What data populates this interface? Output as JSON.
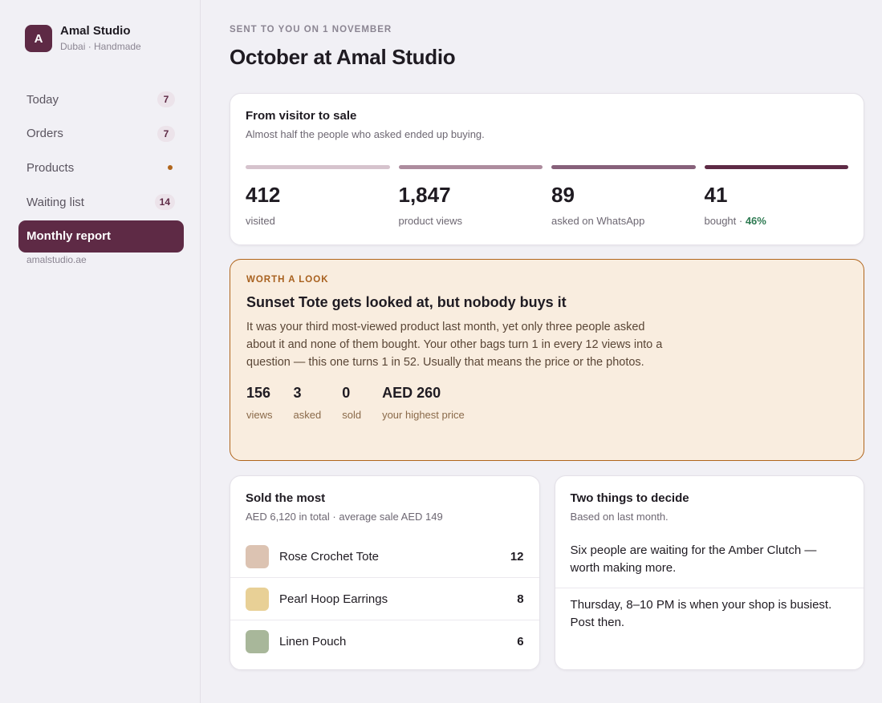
{
  "brand": {
    "initial": "A",
    "name": "Amal Studio",
    "subtitle": "Dubai · Handmade"
  },
  "nav": {
    "items": [
      {
        "label": "Today",
        "badge": "7"
      },
      {
        "label": "Orders",
        "badge": "7"
      },
      {
        "label": "Products",
        "indicator": "dot"
      },
      {
        "label": "Waiting list",
        "badge": "14"
      },
      {
        "label": "Monthly report",
        "active": true
      }
    ],
    "site": "amalstudio.ae"
  },
  "header": {
    "kicker": "SENT TO YOU ON 1 NOVEMBER",
    "title": "October at Amal Studio"
  },
  "funnel": {
    "title": "From visitor to sale",
    "subtitle": "Almost half the people who asked ended up buying.",
    "stages": [
      {
        "value": "412",
        "label": "visited",
        "color": "#d6c3cd"
      },
      {
        "value": "1,847",
        "label": "product views",
        "color": "#ad8c9e"
      },
      {
        "value": "89",
        "label": "asked on WhatsApp",
        "color": "#87617a"
      },
      {
        "value": "41",
        "label": "bought",
        "pct": "46%",
        "color": "#5e2a45"
      }
    ]
  },
  "alert": {
    "kicker": "WORTH A LOOK",
    "title": "Sunset Tote gets looked at, but nobody buys it",
    "body": "It was your third most-viewed product last month, yet only three people asked about it and none of them bought. Your other bags turn 1 in every 12 views into a question — this one turns 1 in 52. Usually that means the price or the photos.",
    "stats": [
      {
        "value": "156",
        "label": "views"
      },
      {
        "value": "3",
        "label": "asked"
      },
      {
        "value": "0",
        "label": "sold"
      },
      {
        "value": "AED 260",
        "label": "your highest price"
      }
    ]
  },
  "sold": {
    "title": "Sold the most",
    "subtitle": "AED 6,120 in total · average sale AED 149",
    "items": [
      {
        "name": "Rose Crochet Tote",
        "count": "12",
        "color": "#dcc3b2"
      },
      {
        "name": "Pearl Hoop Earrings",
        "count": "8",
        "color": "#e8d096"
      },
      {
        "name": "Linen Pouch",
        "count": "6",
        "color": "#a8b79a"
      }
    ]
  },
  "decide": {
    "title": "Two things to decide",
    "subtitle": "Based on last month.",
    "items": [
      "Six people are waiting for the Amber Clutch — worth making more.",
      "Thursday, 8–10 PM is when your shop is busiest. Post then."
    ]
  },
  "colors": {
    "accent": "#5e2a45",
    "warning": "#b0651c",
    "positive": "#2e7a52"
  }
}
